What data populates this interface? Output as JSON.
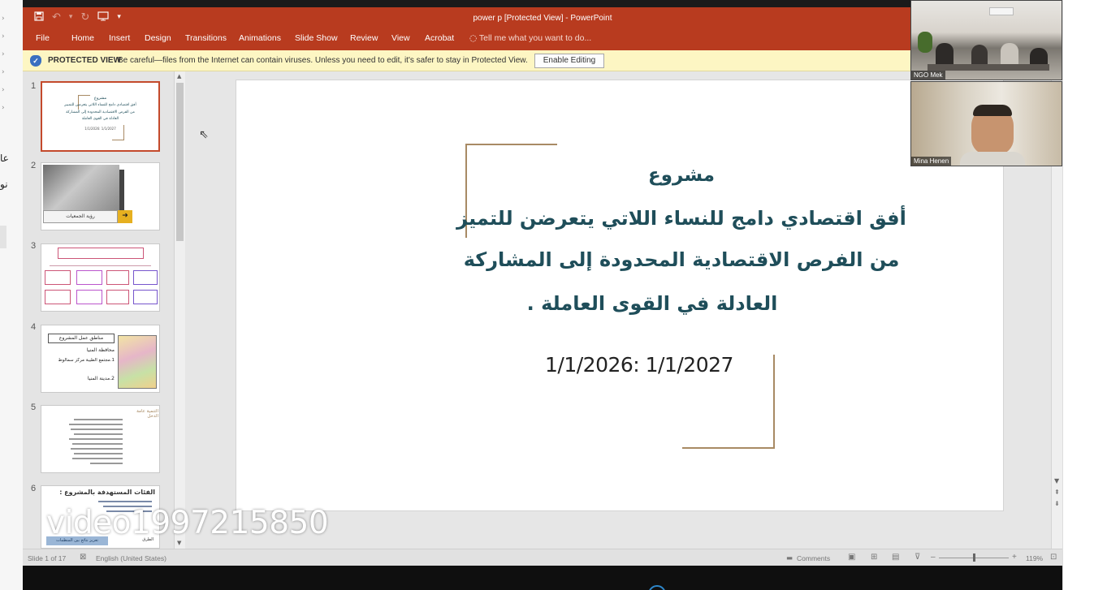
{
  "outer_left": {
    "char_top": "عا",
    "char_bottom": "نو"
  },
  "window": {
    "title": "power p [Protected View] - PowerPoint",
    "qat": {
      "save_icon": "save-icon",
      "undo_icon": "undo-icon",
      "redo_icon": "redo-icon",
      "start_icon": "start-from-beginning-icon"
    }
  },
  "ribbon": {
    "tabs": [
      "File",
      "Home",
      "Insert",
      "Design",
      "Transitions",
      "Animations",
      "Slide Show",
      "Review",
      "View",
      "Acrobat"
    ],
    "tell_me": "Tell me what you want to do..."
  },
  "protected_view": {
    "title": "PROTECTED VIEW",
    "message": "Be careful—files from the Internet can contain viruses. Unless you need to edit, it's safer to stay in Protected View.",
    "button": "Enable Editing"
  },
  "thumbnails": [
    {
      "number": "1",
      "lines": [
        "مشروع",
        "أفق اقتصادي دامج للنساء اللاتي يتعرضن للتمييز",
        "من الفرص الاقتصادية المحدودة إلى المشاركة",
        "العادلة في القوى العاملة",
        "1/1/2026: 1/1/2027"
      ]
    },
    {
      "number": "2",
      "caption": "رؤية الجمعيات"
    },
    {
      "number": "3"
    },
    {
      "number": "4",
      "lines": [
        "مناطق عمل المشروع",
        "محافظة المنيا",
        "1.مجتمع الطيبة مركز سمالوط",
        "2.مدينة المنيا"
      ]
    },
    {
      "number": "5",
      "title": "التنمية عامة الدخل"
    },
    {
      "number": "6",
      "title": "الفئات المستهدفة بالمشروع :",
      "footer_left": "الطرق",
      "footer_btn": "تعزيز نتائج بين المنظمات"
    }
  ],
  "slide": {
    "line1": "مشروع",
    "line2": "أفق اقتصادي دامج للنساء اللاتي يتعرضن للتميز",
    "line3": "من الفرص الاقتصادية المحدودة إلى المشاركة",
    "line4": "العادلة في القوى العاملة .",
    "date": "1/1/2026: 1/1/2027"
  },
  "status_bar": {
    "slide_info": "Slide 1 of 17",
    "language": "English (United States)",
    "comments": "Comments",
    "zoom": "119%"
  },
  "video_tiles": [
    {
      "name": "NGO Mek"
    },
    {
      "name": "Mina Henen"
    }
  ],
  "watermark": "video1997215850",
  "colors": {
    "title_bar": "#b83b1f",
    "message_bar": "#fdf6c3",
    "slide_text": "#1f4e5a",
    "slide_accent": "#a88a64"
  }
}
